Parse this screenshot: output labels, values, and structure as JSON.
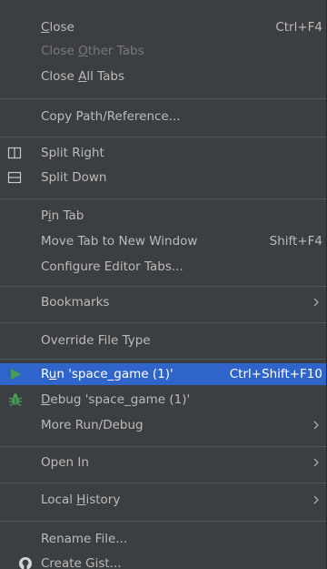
{
  "menu": {
    "close": {
      "pre": "",
      "mn": "C",
      "post": "lose",
      "shortcut": "Ctrl+F4"
    },
    "close_other": {
      "pre": "Close ",
      "mn": "O",
      "post": "ther Tabs"
    },
    "close_all": {
      "pre": "Close ",
      "mn": "A",
      "post": "ll Tabs"
    },
    "copy_path": {
      "label": "Copy Path/Reference..."
    },
    "split_right": {
      "label": "Split Right"
    },
    "split_down": {
      "label": "Split Down"
    },
    "pin_tab": {
      "pre": "P",
      "mn": "i",
      "post": "n Tab"
    },
    "move_tab": {
      "label": "Move Tab to New Window",
      "shortcut": "Shift+F4"
    },
    "configure_tabs": {
      "label": "Configure Editor Tabs..."
    },
    "bookmarks": {
      "label": "Bookmarks"
    },
    "override_type": {
      "label": "Override File Type"
    },
    "run": {
      "pre": "R",
      "mn": "u",
      "post": "n 'space_game (1)'",
      "shortcut": "Ctrl+Shift+F10"
    },
    "debug": {
      "pre": "",
      "mn": "D",
      "post": "ebug 'space_game (1)'"
    },
    "more_run": {
      "label": "More Run/Debug"
    },
    "open_in": {
      "label": "Open In"
    },
    "local_history": {
      "pre": "Local ",
      "mn": "H",
      "post": "istory"
    },
    "rename_file": {
      "label": "Rename File..."
    },
    "create_gist": {
      "label": "Create Gist..."
    }
  },
  "icons": {
    "split_right": "split-right-icon",
    "split_down": "split-down-icon",
    "run": "run-play-icon",
    "debug": "debug-bug-icon",
    "gist": "github-icon",
    "submenu": "chevron-right-icon"
  },
  "colors": {
    "menu_bg": "#3c3f41",
    "text": "#bbbbbb",
    "disabled_text": "#787878",
    "selected_bg": "#2f65ca",
    "separator": "#515658",
    "run_green": "#499c54"
  }
}
